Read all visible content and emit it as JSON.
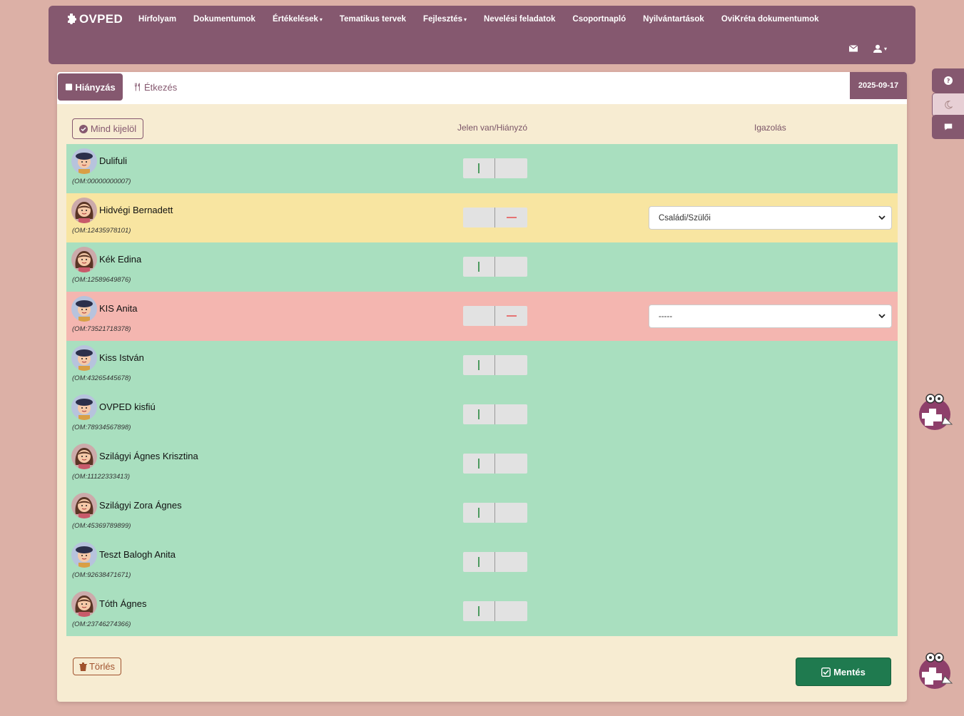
{
  "navbar": {
    "brand": "OVPED",
    "items": [
      {
        "label": "Hírfolyam",
        "caret": false
      },
      {
        "label": "Dokumentumok",
        "caret": false
      },
      {
        "label": "Értékelések",
        "caret": true
      },
      {
        "label": "Tematikus tervek",
        "caret": false
      },
      {
        "label": "Fejlesztés",
        "caret": true
      },
      {
        "label": "Nevelési feladatok",
        "caret": false
      },
      {
        "label": "Csoportnapló",
        "caret": false
      },
      {
        "label": "Nyilvántartások",
        "caret": false
      },
      {
        "label": "OviKréta dokumentumok",
        "caret": false
      }
    ],
    "right_icons": [
      "mail-icon",
      "user-icon"
    ]
  },
  "side_buttons": [
    "help-icon",
    "moon-icon",
    "comment-icon"
  ],
  "tabs": {
    "active_label": "Hiányzás",
    "inactive_label": "Étkezés",
    "date": "2025-09-17"
  },
  "table": {
    "select_all_label": "Mind kijelöl",
    "presence_header": "Jelen van/Hiányzó",
    "justification_header": "Igazolás"
  },
  "students": [
    {
      "name": "Dulifuli",
      "om": "(OM:00000000007)",
      "status": "present",
      "gender": "boy",
      "justification": null
    },
    {
      "name": "Hidvégi Bernadett",
      "om": "(OM:12435978101)",
      "status": "absent-justified",
      "gender": "girl",
      "justification": "Családi/Szülői"
    },
    {
      "name": "Kék Edina",
      "om": "(OM:12589649876)",
      "status": "present",
      "gender": "girl",
      "justification": null
    },
    {
      "name": "KIS Anita",
      "om": "(OM:73521718378)",
      "status": "absent-unjustified",
      "gender": "boy",
      "justification": "-----"
    },
    {
      "name": "Kiss István",
      "om": "(OM:43265445678)",
      "status": "present",
      "gender": "boy",
      "justification": null
    },
    {
      "name": "OVPED kisfiú",
      "om": "(OM:78934567898)",
      "status": "present",
      "gender": "boy",
      "justification": null
    },
    {
      "name": "Szilágyi Ágnes Krisztina",
      "om": "(OM:11122333413)",
      "status": "present",
      "gender": "girl",
      "justification": null
    },
    {
      "name": "Szilágyi Zora Ágnes",
      "om": "(OM:45369789899)",
      "status": "present",
      "gender": "girl",
      "justification": null
    },
    {
      "name": "Teszt Balogh Anita",
      "om": "(OM:92638471671)",
      "status": "present",
      "gender": "boy",
      "justification": null
    },
    {
      "name": "Tóth Ágnes",
      "om": "(OM:23746274366)",
      "status": "present",
      "gender": "girl",
      "justification": null
    }
  ],
  "actions": {
    "delete_label": "Törlés",
    "save_label": "Mentés"
  },
  "colors": {
    "primary": "#85586f",
    "present_row": "#a9dfbf",
    "justified_row": "#f8e5a1",
    "unjustified_row": "#f4b6b0",
    "save": "#1f7a4f",
    "background": "#dcb0a6",
    "card": "#f7ecd2"
  }
}
